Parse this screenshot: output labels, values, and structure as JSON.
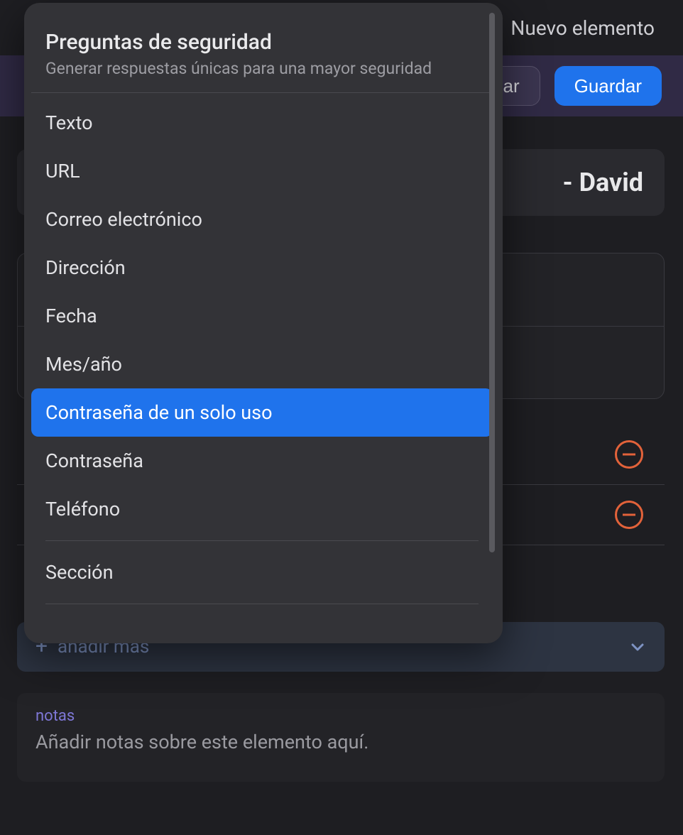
{
  "topbar": {
    "title": "Nuevo elemento"
  },
  "header": {
    "cancel_suffix": "ar",
    "save_label": "Guardar"
  },
  "item": {
    "title_suffix": "- David"
  },
  "add_more": {
    "label": "añadir más"
  },
  "notes": {
    "label": "notas",
    "placeholder": "Añadir notas sobre este elemento aquí."
  },
  "popover": {
    "heading_title": "Preguntas de seguridad",
    "heading_subtitle": "Generar respuestas únicas para una mayor seguridad",
    "items": [
      {
        "label": "Texto"
      },
      {
        "label": "URL"
      },
      {
        "label": "Correo electrónico"
      },
      {
        "label": "Dirección"
      },
      {
        "label": "Fecha"
      },
      {
        "label": "Mes/año"
      },
      {
        "label": "Contraseña de un solo uso",
        "highlighted": true
      },
      {
        "label": "Contraseña"
      },
      {
        "label": "Teléfono"
      }
    ],
    "section_label": "Sección"
  }
}
